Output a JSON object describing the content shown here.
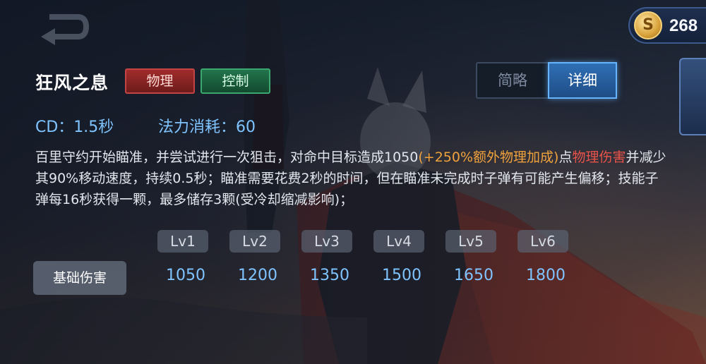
{
  "currency": {
    "icon": "gold-coin-icon",
    "glyph": "S",
    "value": "268"
  },
  "skill": {
    "name": "狂风之息",
    "tags": [
      "物理",
      "控制"
    ],
    "cd": "CD：1.5秒",
    "mana": "法力消耗：60"
  },
  "toggle": {
    "brief": "简略",
    "detail": "详细",
    "selected": "detail"
  },
  "description": {
    "seg1": "百里守约开始瞄准，并尝试进行一次狙击，对命中目标造成1050",
    "seg2": "(+250%额外物理加成)",
    "seg3": "点",
    "seg4": "物理伤害",
    "seg5": "并减少其90%移动速度，持续0.5秒；瞄准需要花费2秒的时间，但在瞄准未完成时子弹有可能产生偏移；技能子弹每16秒获得一颗，最多储存3颗(受冷却缩减影响)；"
  },
  "levels": {
    "headers": [
      "Lv1",
      "Lv2",
      "Lv3",
      "Lv4",
      "Lv5",
      "Lv6"
    ],
    "row_label": "基础伤害",
    "values": [
      "1050",
      "1200",
      "1350",
      "1500",
      "1650",
      "1800"
    ]
  },
  "colors": {
    "accent_blue": "#7fc3ff",
    "bonus_orange": "#f0a23c",
    "physical_red": "#e8534a",
    "tag_physical": "#a02c2c",
    "tag_control": "#22744c"
  }
}
